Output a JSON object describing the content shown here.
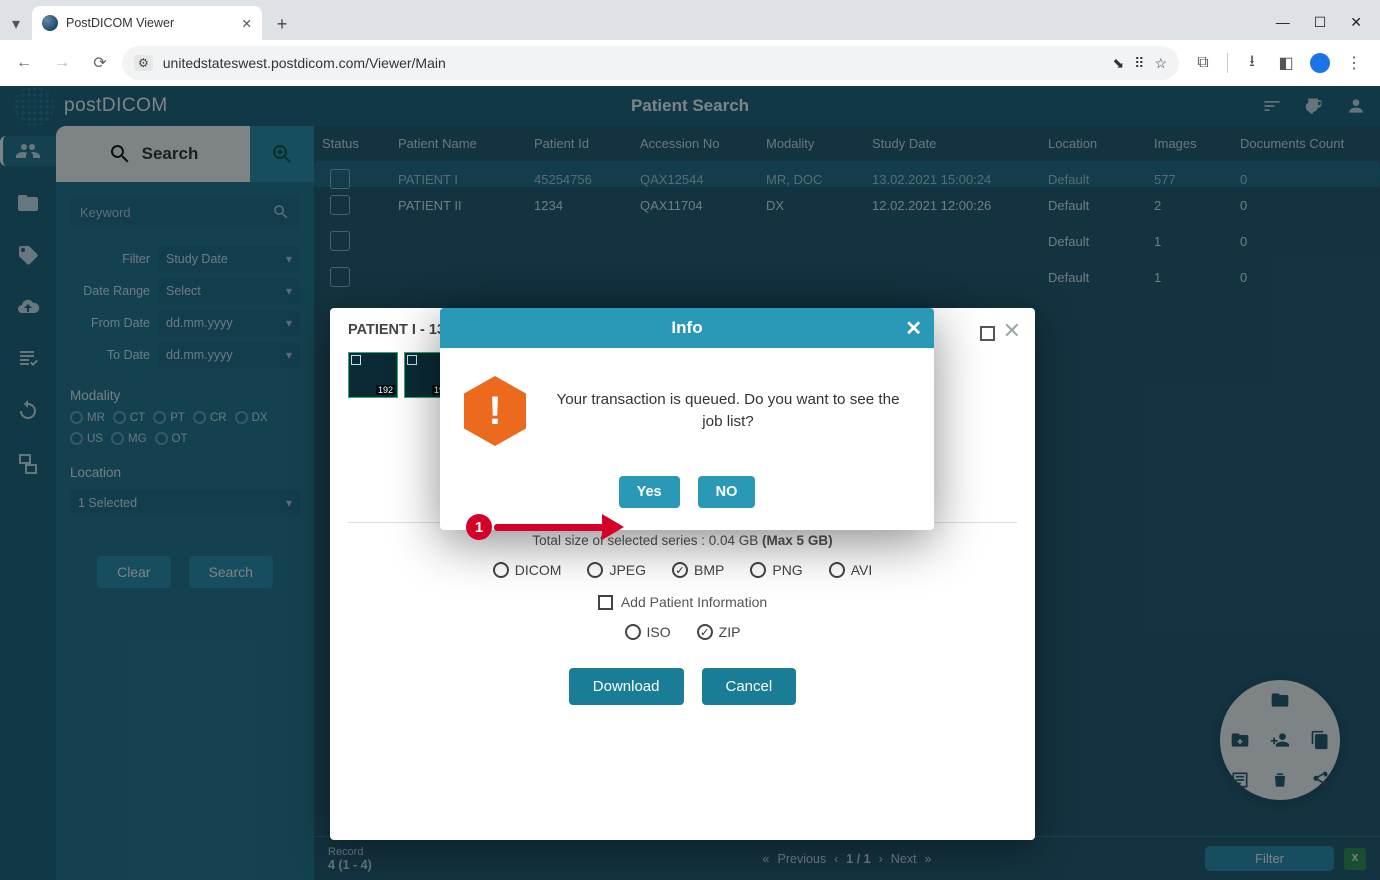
{
  "browser": {
    "tab_title": "PostDICOM Viewer",
    "url": "unitedstateswest.postdicom.com/Viewer/Main"
  },
  "header": {
    "brand": "postDICOM",
    "page_title": "Patient Search"
  },
  "search_panel": {
    "tab_label": "Search",
    "keyword_placeholder": "Keyword",
    "filter_label": "Filter",
    "filter_value": "Study Date",
    "daterange_label": "Date Range",
    "daterange_value": "Select",
    "fromdate_label": "From Date",
    "fromdate_value": "dd.mm.yyyy",
    "todate_label": "To Date",
    "todate_value": "dd.mm.yyyy",
    "modality_label": "Modality",
    "modalities": [
      "MR",
      "CT",
      "PT",
      "CR",
      "DX",
      "US",
      "MG",
      "OT"
    ],
    "location_label": "Location",
    "location_value": "1 Selected",
    "clear_btn": "Clear",
    "search_btn": "Search"
  },
  "table": {
    "cols": [
      "Status",
      "Patient Name",
      "Patient Id",
      "Accession No",
      "Modality",
      "Study Date",
      "Location",
      "Images",
      "Documents Count"
    ],
    "rows": [
      {
        "name": "PATIENT I",
        "pid": "45254756",
        "acc": "QAX12544",
        "mod": "MR, DOC",
        "date": "13.02.2021 15:00:24",
        "loc": "Default",
        "img": "577",
        "doc": "0",
        "sel": true
      },
      {
        "name": "PATIENT II",
        "pid": "1234",
        "acc": "QAX11704",
        "mod": "DX",
        "date": "12.02.2021 12:00:26",
        "loc": "Default",
        "img": "2",
        "doc": "0"
      },
      {
        "name": "",
        "pid": "",
        "acc": "",
        "mod": "",
        "date": "",
        "loc": "Default",
        "img": "1",
        "doc": "0"
      },
      {
        "name": "",
        "pid": "",
        "acc": "",
        "mod": "",
        "date": "",
        "loc": "Default",
        "img": "1",
        "doc": "0"
      }
    ],
    "footer": {
      "record_label": "Record",
      "record_value": "4 (1 - 4)",
      "prev": "Previous",
      "next": "Next",
      "page": "1 / 1",
      "filter": "Filter"
    }
  },
  "download_modal": {
    "title_prefix": "PATIENT I - 13",
    "thumbs": [
      "192",
      "192"
    ],
    "size_line_a": "Total size of selected series : 0.04 GB ",
    "size_line_b": "(Max 5 GB)",
    "formats": [
      "DICOM",
      "JPEG",
      "BMP",
      "PNG",
      "AVI"
    ],
    "format_selected": "BMP",
    "add_patient_info": "Add Patient Information",
    "archives": [
      "ISO",
      "ZIP"
    ],
    "archive_selected": "ZIP",
    "download_btn": "Download",
    "cancel_btn": "Cancel"
  },
  "info_modal": {
    "title": "Info",
    "message": "Your transaction is queued. Do you want to see the job list?",
    "yes": "Yes",
    "no": "NO"
  },
  "annotation": {
    "number": "1"
  }
}
